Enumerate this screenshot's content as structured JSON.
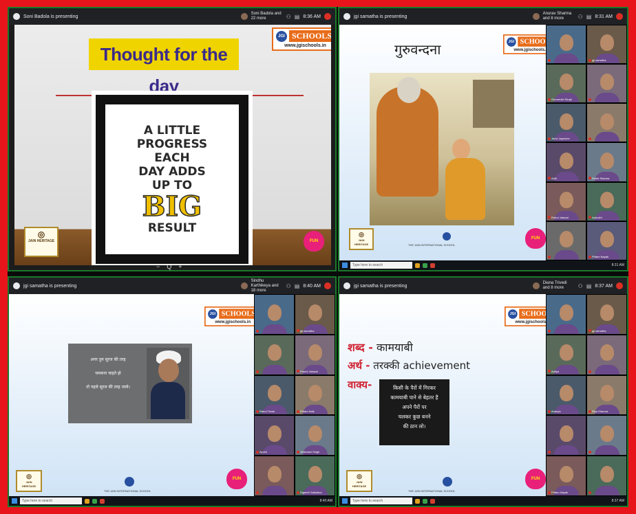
{
  "panels": {
    "p1": {
      "presenter": "Soni Badola is presenting",
      "participants": "Soni Badola and 22 more",
      "time": "8:36 AM",
      "slide_title": "Thought for the day",
      "quote_lines": [
        "A LITTLE",
        "PROGRESS",
        "EACH",
        "DAY ADDS",
        "UP TO"
      ],
      "quote_big": "BIG",
      "quote_end": "RESULT",
      "zoom_controls": [
        "−",
        "Q",
        "+"
      ]
    },
    "p2": {
      "presenter": "jgi samatha is presenting",
      "participants": "Anurav Sharma and 8 more",
      "time": "8:31 AM",
      "slide_title": "गुरुवन्दना",
      "school": "THE JAIN INTERNATIONAL SCHOOL",
      "tiles": [
        "",
        "jgi samatha",
        "Gurumukh Singh",
        "",
        "Jeevi Jayshree",
        "",
        "Aditi",
        "Rashi Sharma",
        "Rahul Jaiswal",
        "Aakruthi",
        "",
        "Pritam Nayak"
      ]
    },
    "p3": {
      "presenter": "jgi samatha is presenting",
      "participants": "Sindhu Karthikeya and 18 more",
      "time": "8:40 AM",
      "quote_lines": [
        "अगर तुम सूरज की तरह",
        "चमकना चाहते हो",
        "तो पहले सूरज की तरह जलो।"
      ],
      "school": "THE JAIN INTERNATIONAL SCHOOL",
      "tiles": [
        "",
        "jgi samatha",
        "",
        "Prachi Jaiswal",
        "Rahul Tiwari",
        "Pritam Naik",
        "Ayush",
        "Vaishnavi Singh",
        "",
        "Diganth Saikatma"
      ]
    },
    "p4": {
      "presenter": "jgi samatha is presenting",
      "participants": "Diana Trivedi and 8 more",
      "time": "8:37 AM",
      "word_label": "शब्द -",
      "word": "कामयाबी",
      "meaning_label": "अर्थ -",
      "meaning": "तरक्की achievement",
      "sentence_label": "वाक्य-",
      "sentence_lines": [
        "किसी के पैरों में गिरकर",
        "कामयाबी पाने से बेहतर है",
        "अपने पैरों पर",
        "चलकर कुछ बनने",
        "की ठान लो।"
      ],
      "school": "THE JAIN INTERNATIONAL SCHOOL",
      "tiles": [
        "",
        "jgi samatha",
        "Aditya",
        "",
        "Ananya",
        "Riya Sharma",
        "",
        "",
        "Pritam Nayak",
        ""
      ]
    }
  },
  "common": {
    "jgi_name": "SCHOOLS",
    "jgi_badge": "JGI",
    "jgi_url": "www.jgischools.in",
    "jain_heritage": "JAIN HERITAGE",
    "fun_label": "FUN",
    "taskbar_search": "Type here to search"
  },
  "colors": {
    "frame": "#e8141c",
    "meet_bar": "#202124",
    "orange": "#e86c1a",
    "slide_blue": "#dbe9f7"
  }
}
